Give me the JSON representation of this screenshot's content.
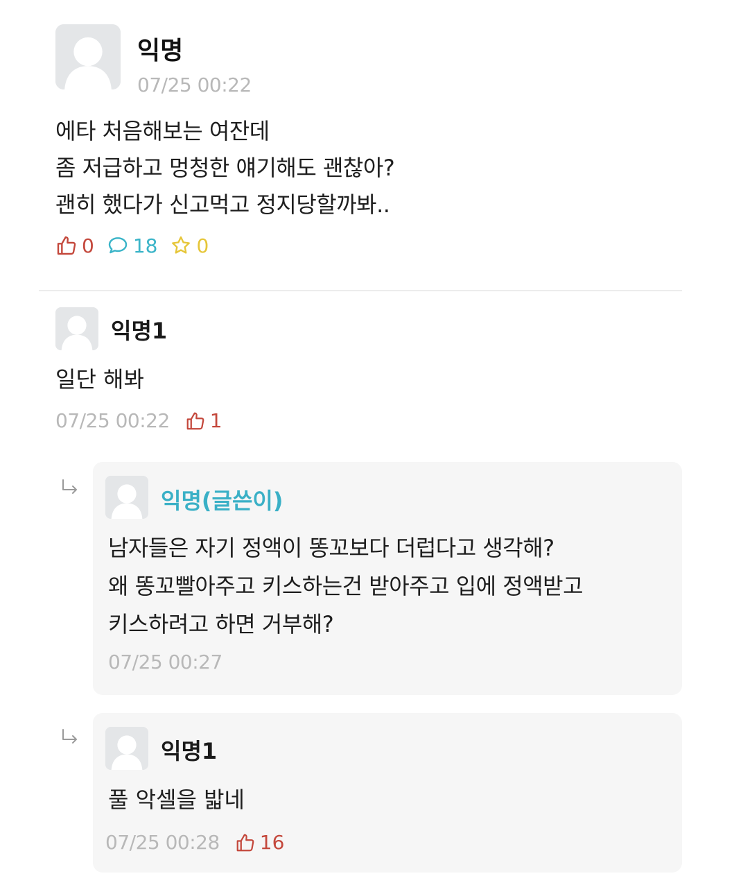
{
  "post": {
    "author": "익명",
    "time": "07/25 00:22",
    "body_lines": [
      "에타 처음해보는 여잔데",
      "좀 저급하고 멍청한 얘기해도 괜찮아?",
      "괜히 했다가 신고먹고 정지당할까봐.."
    ],
    "like_count": "0",
    "comment_count": "18",
    "scrap_count": "0"
  },
  "comments": [
    {
      "author": "익명1",
      "body": "일단 해봐",
      "time": "07/25 00:22",
      "like_count": "1"
    }
  ],
  "replies": [
    {
      "author": "익명(글쓴이)",
      "body_lines": [
        "남자들은 자기 정액이 똥꼬보다 더럽다고 생각해?",
        "왜 똥꼬빨아주고 키스하는건 받아주고 입에 정액받고",
        "키스하려고 하면 거부해?"
      ],
      "time": "07/25 00:27"
    },
    {
      "author": "익명1",
      "body": "풀 악셀을 밟네",
      "time": "07/25 00:28",
      "like_count": "16"
    }
  ],
  "icons": {
    "like": "thumbs-up-icon",
    "comment": "speech-bubble-icon",
    "scrap": "star-icon",
    "reply": "reply-arrow-icon",
    "avatar": "default-avatar-icon"
  },
  "colors": {
    "like": "#c4483c",
    "comment": "#3ab4c8",
    "scrap": "#e6c63a",
    "op_author": "#3ab0c6",
    "timestamp": "#b8b8b8",
    "reply_bg": "#f6f6f6"
  }
}
